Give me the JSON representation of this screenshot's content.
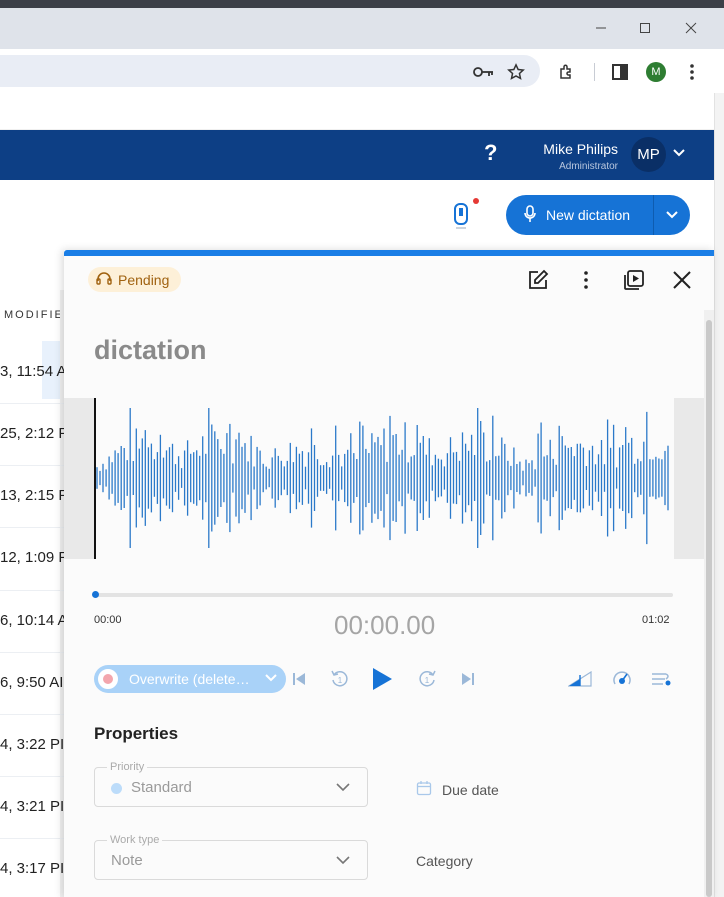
{
  "window": {
    "minimize_icon": "minimize-icon",
    "maximize_icon": "maximize-icon",
    "close_icon": "close-icon"
  },
  "browser_toolbar": {
    "icons": [
      "key-icon",
      "star-icon",
      "extensions-icon",
      "side-panel-icon",
      "menu-dots-icon"
    ],
    "profile_initial": "M",
    "profile_color": "#2e7d32"
  },
  "header": {
    "help_label": "?",
    "user_name": "Mike Philips",
    "user_role": "Administrator",
    "avatar_initials": "MP",
    "brand_color": "#0d3f85"
  },
  "actions": {
    "new_dictation_label": "New dictation",
    "accent_color": "#1673d6"
  },
  "table": {
    "column_header": "MODIFIE",
    "rows": [
      "3, 11:54 A",
      "25, 2:12 F",
      "13, 2:15 F",
      "12, 1:09 F",
      "6, 10:14 A",
      "6, 9:50 AI",
      "4, 3:22 PI",
      "4, 3:21 PI",
      "4, 3:17 PI"
    ]
  },
  "panel": {
    "status_label": "Pending",
    "status_icon": "headphones-icon",
    "title": "dictation",
    "time_start": "00:00",
    "time_end": "01:02",
    "time_current": "00:00.00",
    "progress_fraction": 0.0,
    "mode_label": "Overwrite (delete…",
    "properties_title": "Properties",
    "priority": {
      "label": "Priority",
      "value": "Standard"
    },
    "due_date_label": "Due date",
    "work_type": {
      "label": "Work type",
      "value": "Note"
    },
    "category_label": "Category"
  }
}
